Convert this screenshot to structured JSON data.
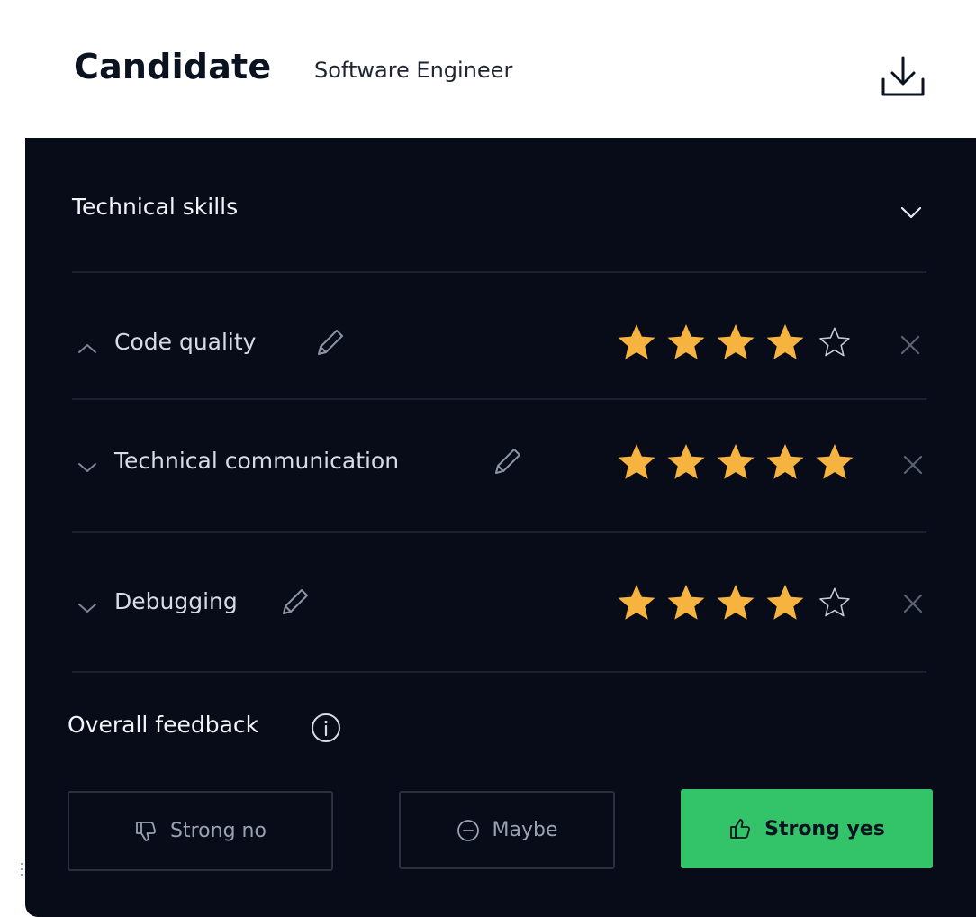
{
  "header": {
    "title": "Candidate",
    "subtitle": "Software Engineer",
    "download_icon": "download-icon"
  },
  "section": {
    "title": "Technical skills",
    "toggle_icon": "chevron-down-icon"
  },
  "skills": [
    {
      "label": "Code quality",
      "expanded": true,
      "rating": 4,
      "max_rating": 5
    },
    {
      "label": "Technical communication",
      "expanded": false,
      "rating": 5,
      "max_rating": 5
    },
    {
      "label": "Debugging",
      "expanded": false,
      "rating": 4,
      "max_rating": 5
    }
  ],
  "overall": {
    "label": "Overall feedback",
    "info_icon": "info-icon",
    "options": [
      {
        "label": "Strong no",
        "icon": "thumbs-down-icon",
        "selected": false
      },
      {
        "label": "Maybe",
        "icon": "minus-circle-icon",
        "selected": false
      },
      {
        "label": "Strong yes",
        "icon": "thumbs-up-icon",
        "selected": true
      }
    ]
  },
  "colors": {
    "panel_bg": "#070c18",
    "star_filled": "#f6b33f",
    "star_empty_stroke": "#c4c9d4",
    "strong_yes_bg": "#33c46a",
    "divider": "#1b2130"
  }
}
